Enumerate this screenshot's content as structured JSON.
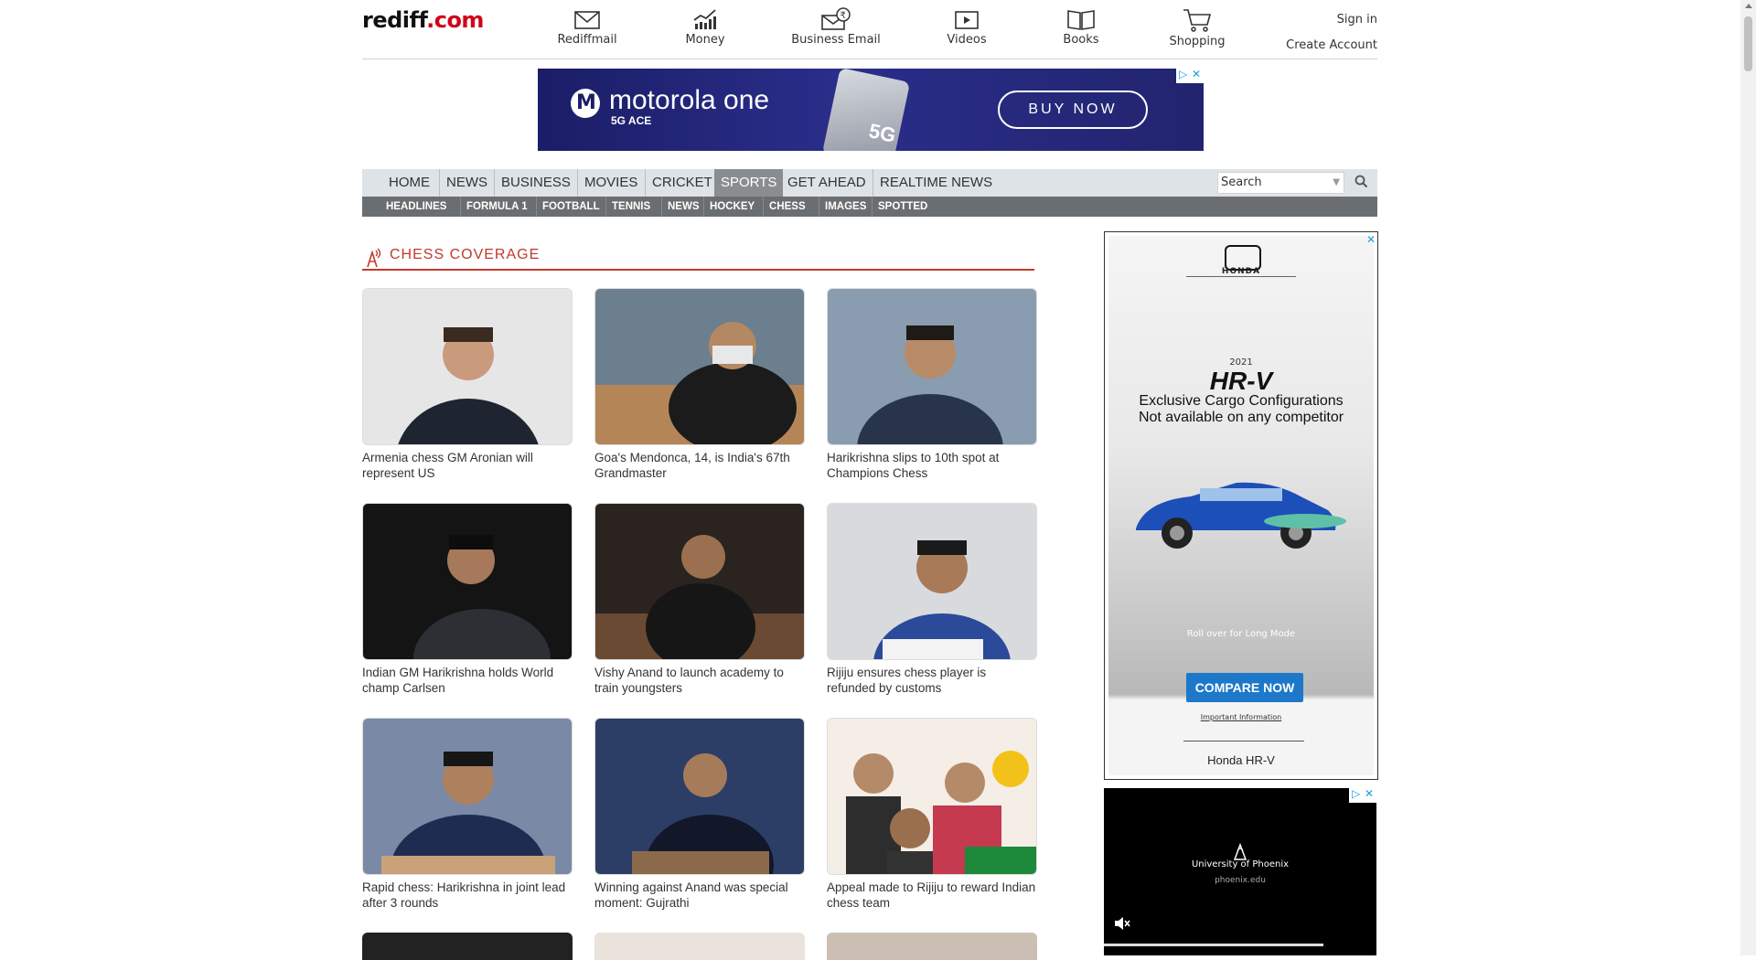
{
  "logo": {
    "part1": "rediff",
    "part2": ".com"
  },
  "topnav": [
    {
      "label": "Rediffmail",
      "icon": "mail-icon"
    },
    {
      "label": "Money",
      "icon": "chart-icon"
    },
    {
      "label": "Business Email",
      "icon": "business-email-icon"
    },
    {
      "label": "Videos",
      "icon": "video-icon"
    },
    {
      "label": "Books",
      "icon": "book-icon"
    },
    {
      "label": "Shopping",
      "icon": "cart-icon"
    }
  ],
  "account": {
    "signin": "Sign in",
    "create": "Create Account"
  },
  "top_ad": {
    "brand": "motorola one",
    "sub": "5G ACE",
    "badge": "5G",
    "cta": "BUY NOW"
  },
  "secnav": {
    "items": [
      "HOME",
      "NEWS",
      "BUSINESS",
      "MOVIES",
      "CRICKET",
      "SPORTS",
      "GET AHEAD",
      "REALTIME NEWS"
    ],
    "active": "SPORTS",
    "search_placeholder": "Search"
  },
  "subnav": [
    "HEADLINES",
    "FORMULA 1",
    "FOOTBALL",
    "TENNIS",
    "NEWS",
    "HOCKEY",
    "CHESS",
    "IMAGES",
    "SPOTTED"
  ],
  "section_title": "CHESS COVERAGE",
  "stories": [
    {
      "caption": "Armenia chess GM Aronian will represent US",
      "bg": "#cfcfcf"
    },
    {
      "caption": "Goa's Mendonca, 14, is India's 67th Grandmaster",
      "bg": "#8a6a4a"
    },
    {
      "caption": "Harikrishna slips to 10th spot at Champions Chess",
      "bg": "#7f93a8"
    },
    {
      "caption": "Indian GM Harikrishna holds World champ Carlsen",
      "bg": "#1f1f1f"
    },
    {
      "caption": "Vishy Anand to launch academy to train youngsters",
      "bg": "#3a2d25"
    },
    {
      "caption": "Rijiju ensures chess player is refunded by customs",
      "bg": "#cdd0d4"
    },
    {
      "caption": "Rapid chess: Harikrishna in joint lead after 3 rounds",
      "bg": "#4a5a78"
    },
    {
      "caption": "Winning against Anand was special moment: Gujrathi",
      "bg": "#2b3a5b"
    },
    {
      "caption": "Appeal made to Rijiju to reward Indian chess team",
      "bg": "#f0e8df"
    }
  ],
  "right_ad": {
    "brand": "HONDA",
    "year": "2021",
    "model": "HR-V",
    "line1": "Exclusive Cargo Configurations",
    "line2": "Not available on any competitor",
    "roll": "Roll over for Long Mode",
    "cta": "COMPARE NOW",
    "info": "Important Information",
    "footer": "Honda HR-V"
  },
  "video_ad": {
    "brand": "University of Phoenix",
    "url": "phoenix.edu"
  }
}
